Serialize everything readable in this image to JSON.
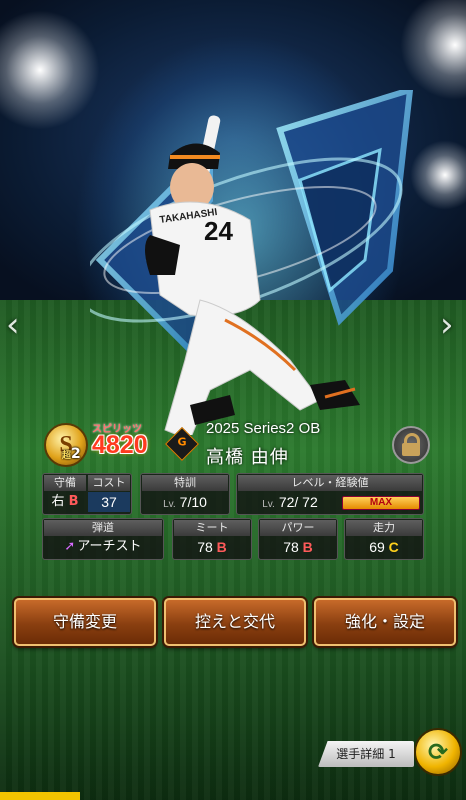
{
  "nav": {
    "prev": "‹",
    "next": "›"
  },
  "player": {
    "rank_letter": "S",
    "rank_sub_prefix": "超",
    "rank_sub_num": "2",
    "spirits_label": "スピリッツ",
    "spirits_value": "4820",
    "series": "2025 Series2 OB",
    "name": "高橋 由伸",
    "number": "24",
    "uniform_name": "TAKAHASHI"
  },
  "stats": {
    "position": {
      "label": "守備",
      "value": "右",
      "grade": "B"
    },
    "cost": {
      "label": "コスト",
      "value": "37"
    },
    "training": {
      "label": "特訓",
      "lv": "Lv.",
      "value": "7/10"
    },
    "level": {
      "label": "レベル・経験値",
      "lv": "Lv.",
      "value": "72/ 72",
      "max": "MAX"
    },
    "trajectory": {
      "label": "弾道",
      "value": "アーチスト"
    },
    "meet": {
      "label": "ミート",
      "value": "78",
      "grade": "B"
    },
    "power": {
      "label": "パワー",
      "value": "78",
      "grade": "B"
    },
    "speed": {
      "label": "走力",
      "value": "69",
      "grade": "C"
    }
  },
  "buttons": {
    "defense": "守備変更",
    "swap": "控えと交代",
    "enhance": "強化・設定"
  },
  "footer": {
    "detail": "選手詳細 1"
  },
  "colors": {
    "button": "#8a3f10",
    "grade_b": "#ff5a5a",
    "grade_c": "#ffd21c",
    "spirits": "#ff3b20"
  }
}
